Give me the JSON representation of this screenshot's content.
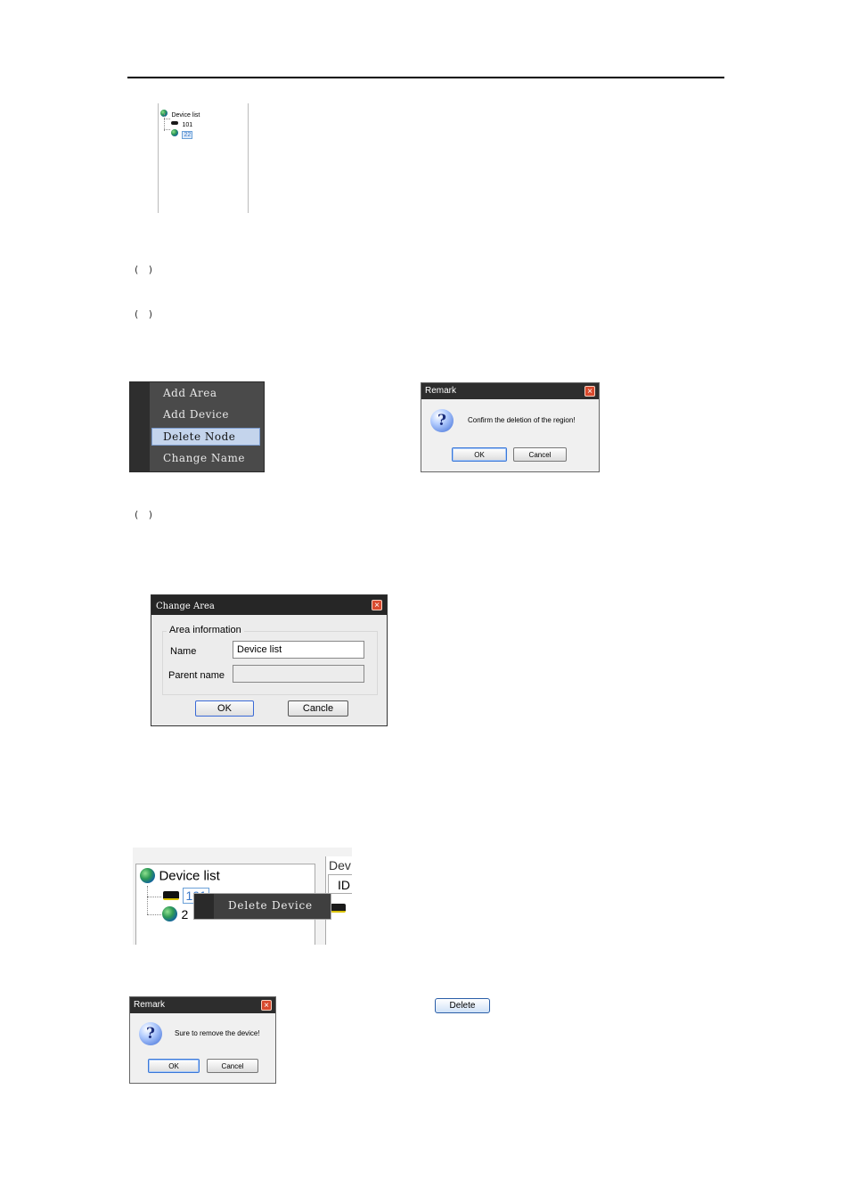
{
  "tree_small": {
    "root_label": "Device list",
    "device_label": "101",
    "area_label": "22"
  },
  "parens": [
    "( )",
    "( )",
    "( )"
  ],
  "context_menu": {
    "items": [
      "Add Area",
      "Add Device",
      "Delete Node",
      "Change Name"
    ],
    "selected_index": 2
  },
  "remark_region": {
    "title": "Remark",
    "message": "Confirm the deletion of the region!",
    "ok": "OK",
    "cancel": "Cancel"
  },
  "change_area": {
    "title": "Change Area",
    "group_label": "Area information",
    "name_label": "Name",
    "name_value": "Device list",
    "parent_label": "Parent name",
    "parent_value": "",
    "ok": "OK",
    "cancel": "Cancle"
  },
  "tree_big": {
    "root_label": "Device list",
    "device_label": "101",
    "area_label_partial": "2",
    "right_header": "Dev",
    "right_col": "ID",
    "context_item": "Delete Device"
  },
  "remark_device": {
    "title": "Remark",
    "message": "Sure to remove the device!",
    "ok": "OK",
    "cancel": "Cancel"
  },
  "delete_button": "Delete",
  "colors": {
    "title_bar": "#2d2d2d",
    "menu_bg": "#4a4a4a",
    "menu_selected": "#c4d4ec",
    "close_button": "#d84a2e"
  }
}
